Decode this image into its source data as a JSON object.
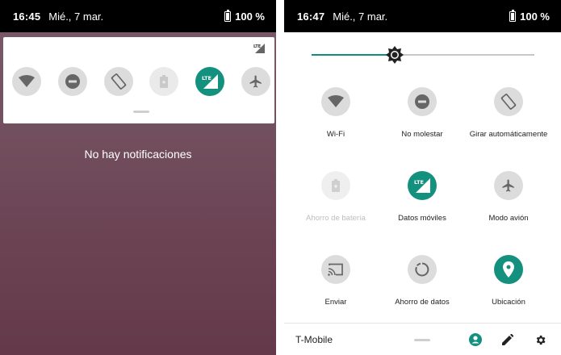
{
  "left_screen": {
    "status_bar": {
      "time": "16:45",
      "date": "Mié., 7 mar.",
      "battery": "100 %"
    },
    "quick_tiles": [
      {
        "icon": "wifi-icon",
        "state": "on"
      },
      {
        "icon": "do-not-disturb-icon",
        "state": "on"
      },
      {
        "icon": "auto-rotate-icon",
        "state": "on"
      },
      {
        "icon": "battery-saver-icon",
        "state": "disabled"
      },
      {
        "icon": "lte-signal-icon",
        "state": "active",
        "badge": "LTE"
      },
      {
        "icon": "airplane-icon",
        "state": "on"
      }
    ],
    "empty_message": "No hay notificaciones",
    "mini_network_badge": "LTE"
  },
  "right_screen": {
    "status_bar": {
      "time": "16:47",
      "date": "Mié., 7 mar.",
      "battery": "100 %"
    },
    "brightness": {
      "level": 0.35
    },
    "tiles": [
      {
        "label": "Wi-Fi",
        "icon": "wifi-icon",
        "state": "on"
      },
      {
        "label": "No molestar",
        "icon": "do-not-disturb-icon",
        "state": "on"
      },
      {
        "label": "Girar automáticamente",
        "icon": "auto-rotate-icon",
        "state": "on"
      },
      {
        "label": "Ahorro de batería",
        "icon": "battery-saver-icon",
        "state": "disabled"
      },
      {
        "label": "Datos móviles",
        "icon": "lte-signal-icon",
        "state": "active",
        "badge": "LTE"
      },
      {
        "label": "Modo avión",
        "icon": "airplane-icon",
        "state": "on"
      },
      {
        "label": "Enviar",
        "icon": "cast-icon",
        "state": "on"
      },
      {
        "label": "Ahorro de datos",
        "icon": "data-saver-icon",
        "state": "on"
      },
      {
        "label": "Ubicación",
        "icon": "location-icon",
        "state": "active"
      }
    ],
    "bottom_bar": {
      "carrier": "T-Mobile",
      "icons": [
        "user-icon",
        "edit-icon",
        "settings-icon"
      ]
    }
  },
  "colors": {
    "accent": "#14907e",
    "tile_bg": "#dcdcdc",
    "status_bar": "#000000"
  }
}
